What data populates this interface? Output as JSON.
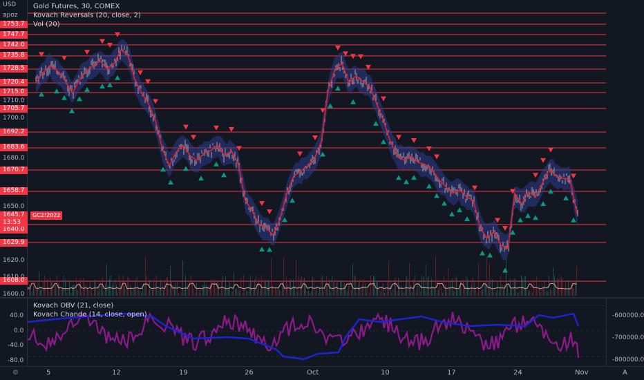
{
  "header": {
    "currency": "USD",
    "user": "apoz",
    "legend": [
      "Gold Futures, 30, COMEX",
      "Kovach Reversals (20, close, 2)",
      "Vol (20)"
    ]
  },
  "price_axis": {
    "labels": [
      "1710.0",
      "1700.0",
      "1680.0",
      "1650.0",
      "1620.0",
      "1610.0",
      "1600.0"
    ],
    "levels": [
      "1753.7",
      "1747.7",
      "1742.0",
      "1735.8",
      "1728.5",
      "1720.4",
      "1715.0",
      "1705.7",
      "1692.2",
      "1683.6",
      "1670.7",
      "1658.7",
      "1640.0",
      "1629.9",
      "1608.0"
    ],
    "current_price": "1645.7",
    "countdown": "13:53",
    "symbol_tag": "GC2!2022"
  },
  "lower_pane": {
    "legend": [
      "Kovach OBV (21, close)",
      "Kovach Chande (14, close, open)"
    ],
    "left_labels": [
      "40.0",
      "0.0",
      "-40.0",
      "-80.0"
    ],
    "right_labels": [
      "-600000.0",
      "-700000.0",
      "-800000.0"
    ]
  },
  "time_axis": {
    "ticks": [
      "5",
      "12",
      "19",
      "26",
      "Oct",
      "10",
      "17",
      "24",
      "Nov"
    ],
    "corner": "A"
  },
  "colors": {
    "background": "#131722",
    "level_line": "#f23645",
    "up_marker": "#089981",
    "down_marker": "#f23645",
    "band": "#2b3d8c",
    "trend_line": "#e0232f",
    "obv_line": "#1c25d6",
    "chande_line": "#8d1a8a"
  },
  "icons": {
    "settings": "gear-icon"
  }
}
